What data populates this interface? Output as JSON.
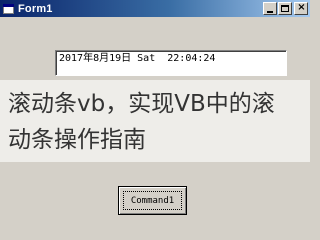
{
  "window": {
    "title": "Form1",
    "controls": {
      "minimize": "minimize",
      "maximize": "maximize",
      "close": "close"
    }
  },
  "textbox": {
    "value": "2017年8月19日 Sat  22:04:24"
  },
  "overlay": {
    "line1": "滚动条vb，实现VB中的滚",
    "line2": "动条操作指南"
  },
  "command_button": {
    "label": "Command1"
  },
  "colors": {
    "titlebar_start": "#0a246a",
    "titlebar_end": "#a6caf0",
    "face": "#d4d0c8"
  }
}
